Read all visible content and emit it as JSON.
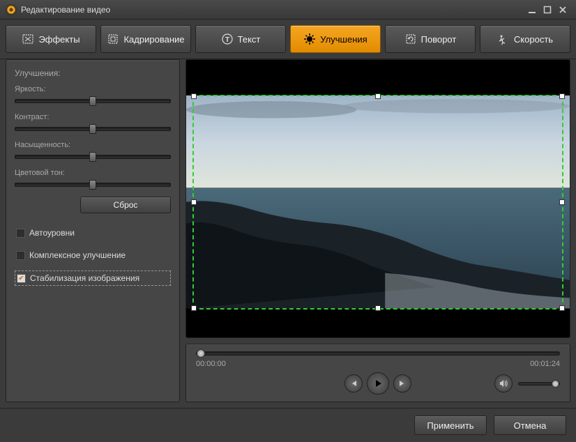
{
  "window": {
    "title": "Редактирование видео"
  },
  "tabs": {
    "effects": "Эффекты",
    "crop": "Кадрирование",
    "text": "Текст",
    "enhance": "Улучшения",
    "rotate": "Поворот",
    "speed": "Скорость"
  },
  "sidebar": {
    "title": "Улучшения:",
    "brightness": {
      "label": "Яркость:",
      "value": 50
    },
    "contrast": {
      "label": "Контраст:",
      "value": 50
    },
    "saturation": {
      "label": "Насыщенность:",
      "value": 50
    },
    "hue": {
      "label": "Цветовой тон:",
      "value": 50
    },
    "reset": "Сброс",
    "auto_levels": {
      "label": "Автоуровни",
      "checked": false
    },
    "complex_enhance": {
      "label": "Комплексное улучшение",
      "checked": false
    },
    "stabilization": {
      "label": "Стабилизация изображения",
      "checked": true
    }
  },
  "timeline": {
    "current": "00:00:00",
    "total": "00:01:24"
  },
  "footer": {
    "apply": "Применить",
    "cancel": "Отмена"
  }
}
